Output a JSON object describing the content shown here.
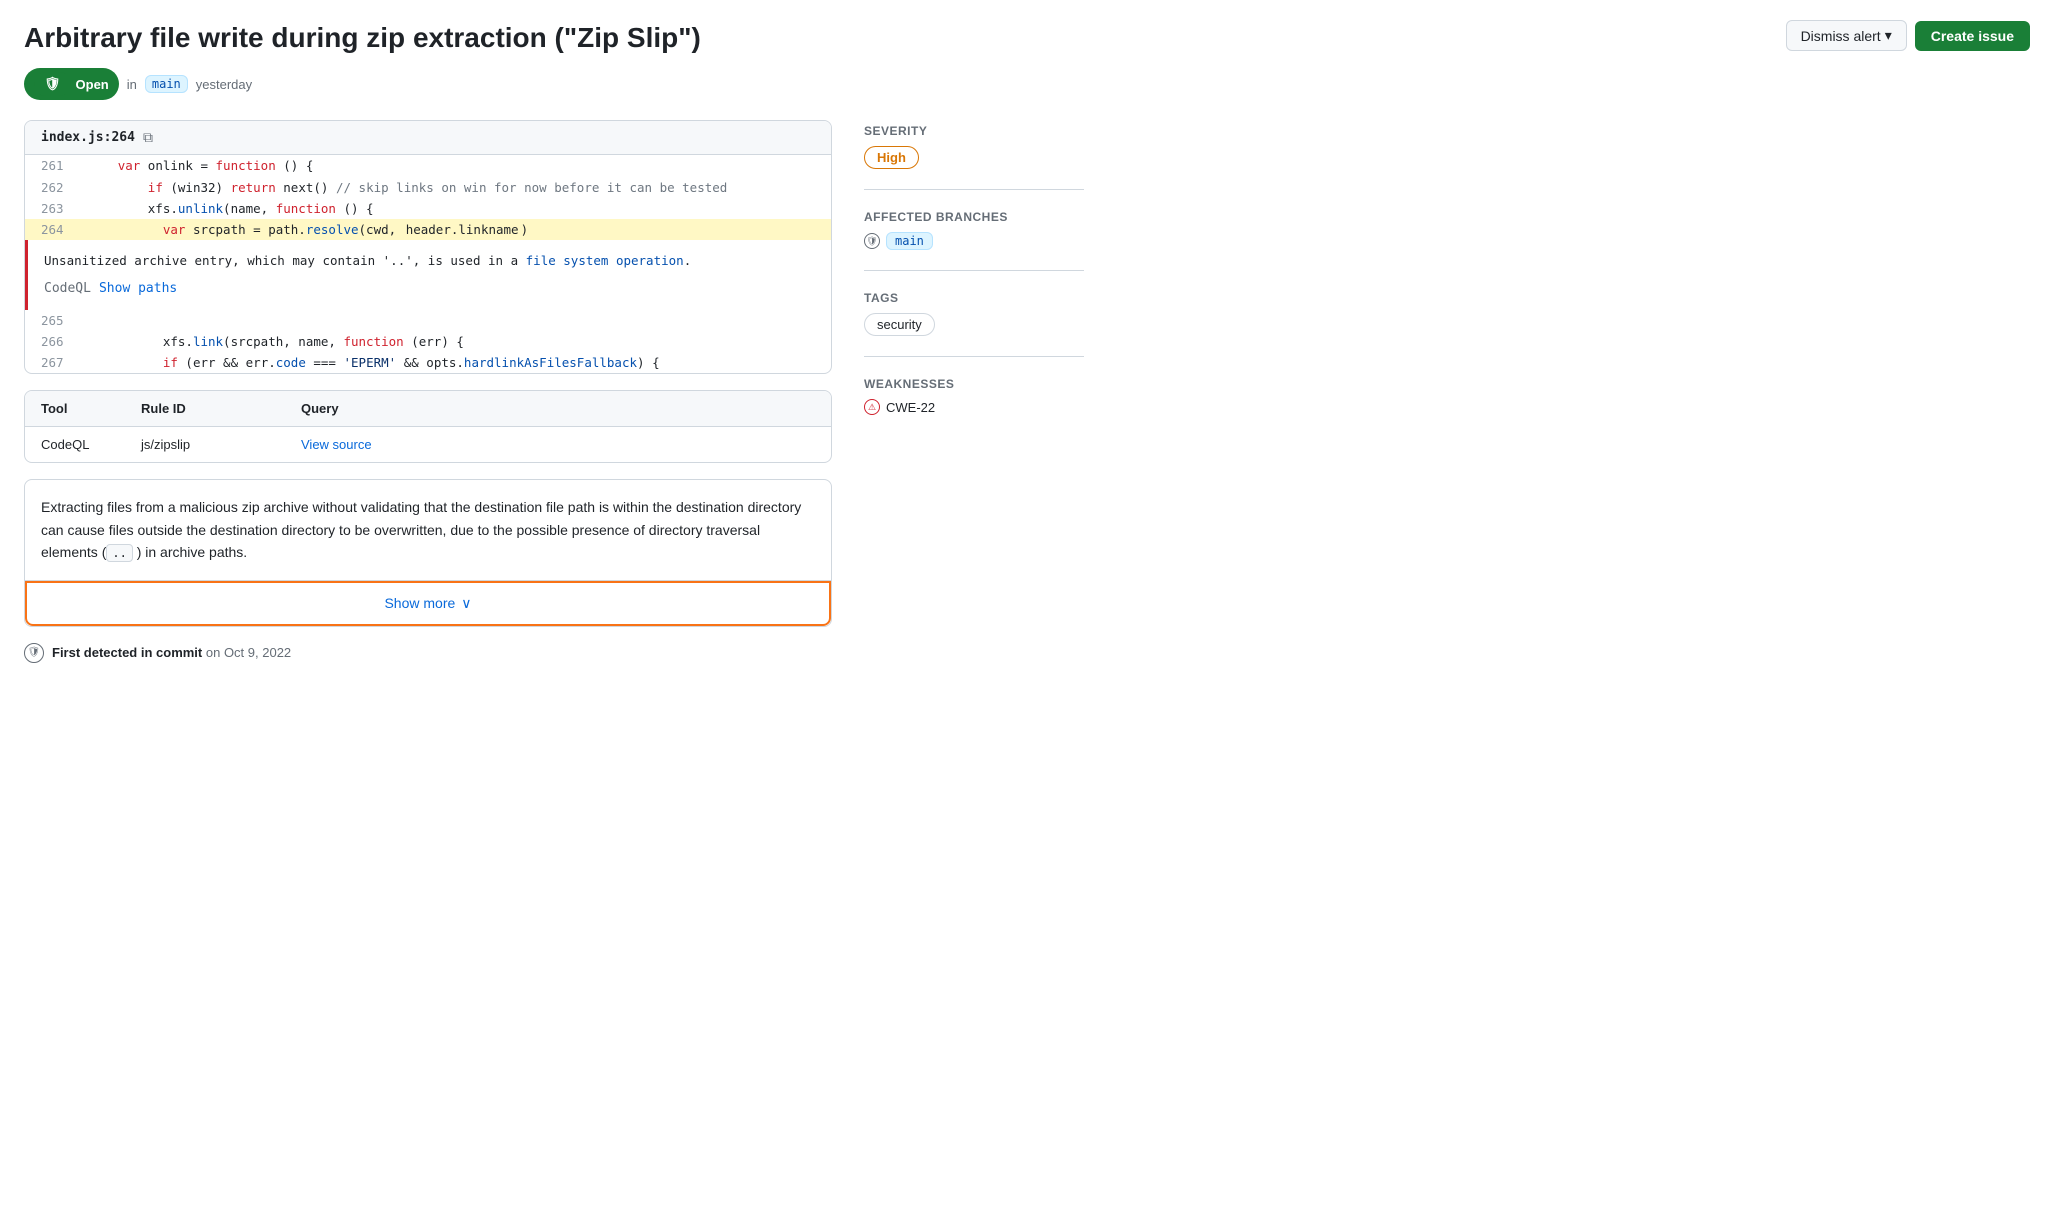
{
  "header": {
    "title": "Arbitrary file write during zip extraction (\"Zip Slip\")",
    "status": "Open",
    "branch": "main",
    "time": "yesterday",
    "dismiss_label": "Dismiss alert",
    "create_label": "Create issue"
  },
  "code_block": {
    "filename": "index.js",
    "line_number": "264",
    "lines": [
      {
        "num": "261",
        "content": "    var onlink = function () {",
        "highlight": false
      },
      {
        "num": "262",
        "content": "        if (win32) return next() // skip links on win for now before it can be tested",
        "highlight": false
      },
      {
        "num": "263",
        "content": "        xfs.unlink(name, function () {",
        "highlight": false
      },
      {
        "num": "264",
        "content": "          var srcpath = path.resolve(cwd, header.linkname)",
        "highlight": true
      }
    ],
    "alert_text": "Unsanitized archive entry, which may contain '..', is used in a file system operation.",
    "codeql_label": "CodeQL",
    "show_paths_label": "Show paths",
    "lines_after": [
      {
        "num": "265",
        "content": ""
      },
      {
        "num": "266",
        "content": "          xfs.link(srcpath, name, function (err) {"
      },
      {
        "num": "267",
        "content": "          if (err && err.code === 'EPERM' && opts.hardlinkAsFilesFallback) {"
      }
    ]
  },
  "info_table": {
    "headers": [
      "Tool",
      "Rule ID",
      "Query"
    ],
    "row": {
      "tool": "CodeQL",
      "rule_id": "js/zipslip",
      "query": "View source"
    }
  },
  "description": {
    "text_parts": [
      "Extracting files from a malicious zip archive without validating that the destination file path is within the destination directory can cause files outside the destination directory to be overwritten, due to the possible presence of directory traversal elements (",
      " ) in archive paths."
    ],
    "code_inline": "..",
    "show_more_label": "Show more"
  },
  "commit_info": {
    "label": "First detected in commit",
    "date": "on Oct 9, 2022"
  },
  "sidebar": {
    "severity_label": "Severity",
    "severity_value": "High",
    "affected_branches_label": "Affected branches",
    "branch_name": "main",
    "tags_label": "Tags",
    "tag": "security",
    "weaknesses_label": "Weaknesses",
    "weakness": "CWE-22"
  }
}
